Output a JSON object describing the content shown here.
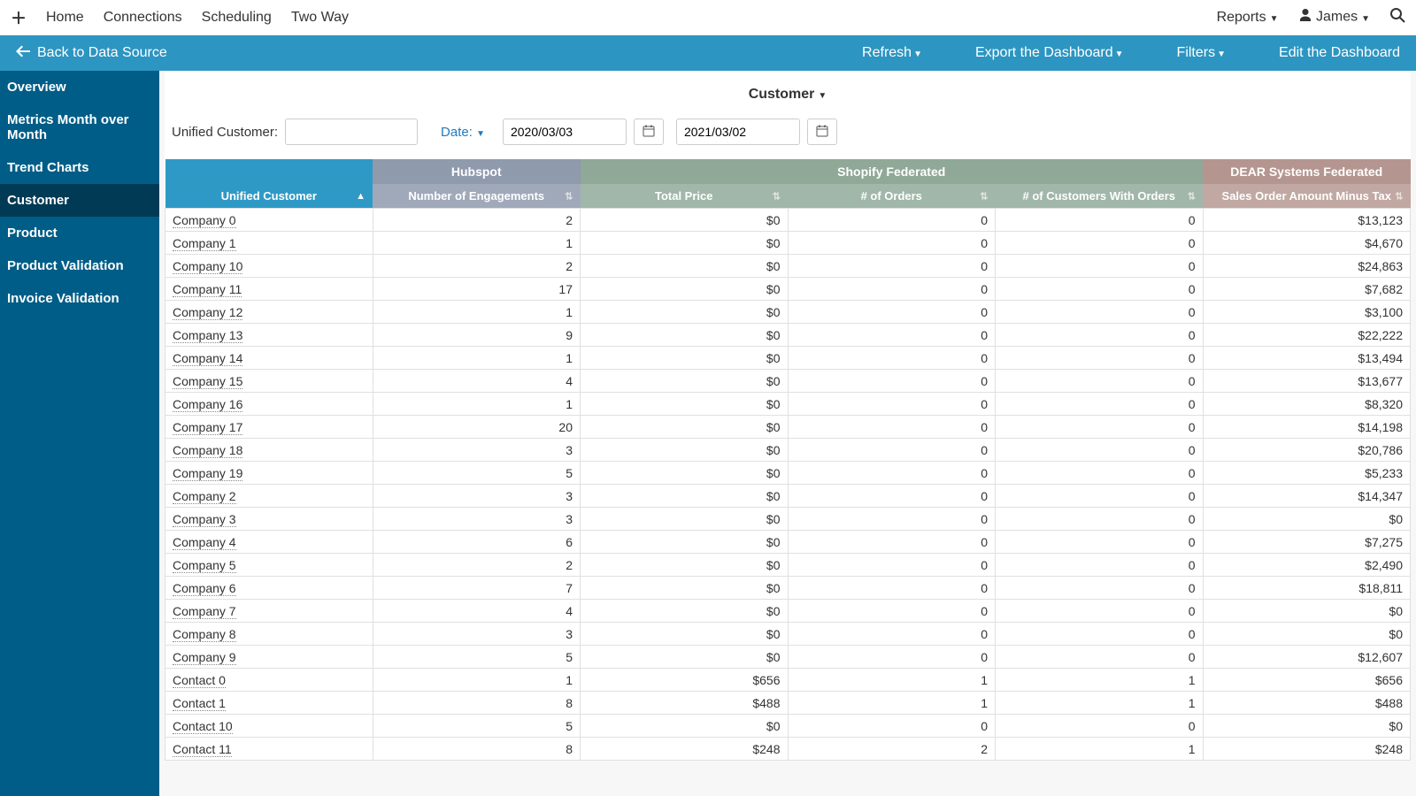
{
  "topnav": {
    "items": [
      "Home",
      "Connections",
      "Scheduling",
      "Two Way"
    ],
    "reports": "Reports",
    "user": "James"
  },
  "actionbar": {
    "back": "Back to Data Source",
    "items": [
      "Refresh",
      "Export the Dashboard",
      "Filters",
      "Edit the Dashboard"
    ]
  },
  "sidebar": {
    "items": [
      "Overview",
      "Metrics Month over Month",
      "Trend Charts",
      "Customer",
      "Product",
      "Product Validation",
      "Invoice Validation"
    ],
    "activeIndex": 3
  },
  "page": {
    "title": "Customer",
    "filterLabel": "Unified Customer:",
    "filterValue": "",
    "dateLabel": "Date:",
    "dateStart": "2020/03/03",
    "dateEnd": "2021/03/02"
  },
  "table": {
    "groupHeaders": [
      "",
      "Hubspot",
      "Shopify Federated",
      "DEAR Systems Federated"
    ],
    "groupSpans": [
      1,
      1,
      3,
      1
    ],
    "columns": [
      "Unified Customer",
      "Number of Engagements",
      "Total Price",
      "# of Orders",
      "# of Customers With Orders",
      "Sales Order Amount Minus Tax"
    ],
    "rows": [
      {
        "name": "Company 0",
        "eng": "2",
        "price": "$0",
        "orders": "0",
        "cust": "0",
        "sales": "$13,123"
      },
      {
        "name": "Company 1",
        "eng": "1",
        "price": "$0",
        "orders": "0",
        "cust": "0",
        "sales": "$4,670"
      },
      {
        "name": "Company 10",
        "eng": "2",
        "price": "$0",
        "orders": "0",
        "cust": "0",
        "sales": "$24,863"
      },
      {
        "name": "Company 11",
        "eng": "17",
        "price": "$0",
        "orders": "0",
        "cust": "0",
        "sales": "$7,682"
      },
      {
        "name": "Company 12",
        "eng": "1",
        "price": "$0",
        "orders": "0",
        "cust": "0",
        "sales": "$3,100"
      },
      {
        "name": "Company 13",
        "eng": "9",
        "price": "$0",
        "orders": "0",
        "cust": "0",
        "sales": "$22,222"
      },
      {
        "name": "Company 14",
        "eng": "1",
        "price": "$0",
        "orders": "0",
        "cust": "0",
        "sales": "$13,494"
      },
      {
        "name": "Company 15",
        "eng": "4",
        "price": "$0",
        "orders": "0",
        "cust": "0",
        "sales": "$13,677"
      },
      {
        "name": "Company 16",
        "eng": "1",
        "price": "$0",
        "orders": "0",
        "cust": "0",
        "sales": "$8,320"
      },
      {
        "name": "Company 17",
        "eng": "20",
        "price": "$0",
        "orders": "0",
        "cust": "0",
        "sales": "$14,198"
      },
      {
        "name": "Company 18",
        "eng": "3",
        "price": "$0",
        "orders": "0",
        "cust": "0",
        "sales": "$20,786"
      },
      {
        "name": "Company 19",
        "eng": "5",
        "price": "$0",
        "orders": "0",
        "cust": "0",
        "sales": "$5,233"
      },
      {
        "name": "Company 2",
        "eng": "3",
        "price": "$0",
        "orders": "0",
        "cust": "0",
        "sales": "$14,347"
      },
      {
        "name": "Company 3",
        "eng": "3",
        "price": "$0",
        "orders": "0",
        "cust": "0",
        "sales": "$0"
      },
      {
        "name": "Company 4",
        "eng": "6",
        "price": "$0",
        "orders": "0",
        "cust": "0",
        "sales": "$7,275"
      },
      {
        "name": "Company 5",
        "eng": "2",
        "price": "$0",
        "orders": "0",
        "cust": "0",
        "sales": "$2,490"
      },
      {
        "name": "Company 6",
        "eng": "7",
        "price": "$0",
        "orders": "0",
        "cust": "0",
        "sales": "$18,811"
      },
      {
        "name": "Company 7",
        "eng": "4",
        "price": "$0",
        "orders": "0",
        "cust": "0",
        "sales": "$0"
      },
      {
        "name": "Company 8",
        "eng": "3",
        "price": "$0",
        "orders": "0",
        "cust": "0",
        "sales": "$0"
      },
      {
        "name": "Company 9",
        "eng": "5",
        "price": "$0",
        "orders": "0",
        "cust": "0",
        "sales": "$12,607"
      },
      {
        "name": "Contact 0",
        "eng": "1",
        "price": "$656",
        "orders": "1",
        "cust": "1",
        "sales": "$656"
      },
      {
        "name": "Contact 1",
        "eng": "8",
        "price": "$488",
        "orders": "1",
        "cust": "1",
        "sales": "$488"
      },
      {
        "name": "Contact 10",
        "eng": "5",
        "price": "$0",
        "orders": "0",
        "cust": "0",
        "sales": "$0"
      },
      {
        "name": "Contact 11",
        "eng": "8",
        "price": "$248",
        "orders": "2",
        "cust": "1",
        "sales": "$248"
      }
    ]
  }
}
